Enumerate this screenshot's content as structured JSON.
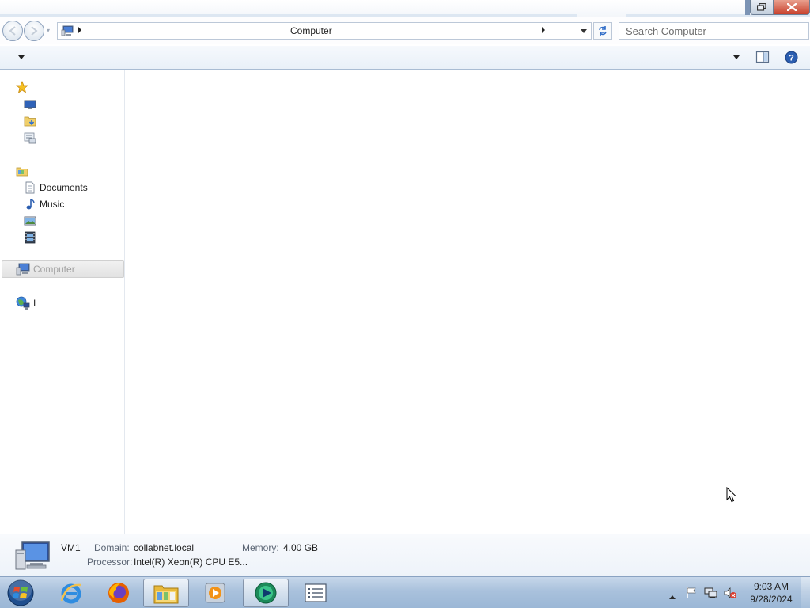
{
  "window": {
    "title_bar": {
      "restore_icon": "restore-icon",
      "close_icon": "close-icon"
    }
  },
  "nav": {
    "back_icon": "back-arrow-icon",
    "forward_icon": "forward-arrow-icon",
    "breadcrumb": "Computer",
    "refresh_icon": "refresh-icon",
    "search_placeholder": "Search Computer"
  },
  "sidebar": {
    "items": [
      {
        "icon": "favorites-star-icon",
        "label": ""
      },
      {
        "icon": "desktop-icon",
        "label": ""
      },
      {
        "icon": "downloads-icon",
        "label": ""
      },
      {
        "icon": "recent-places-icon",
        "label": ""
      },
      {
        "icon": "libraries-icon",
        "label": ""
      },
      {
        "icon": "documents-icon",
        "label": "Documents"
      },
      {
        "icon": "music-icon",
        "label": "Music"
      },
      {
        "icon": "pictures-icon",
        "label": ""
      },
      {
        "icon": "videos-icon",
        "label": ""
      },
      {
        "icon": "computer-icon",
        "label": "Computer"
      },
      {
        "icon": "network-icon",
        "label": "I"
      }
    ]
  },
  "details": {
    "name": "VM1",
    "domain_label": "Domain:",
    "domain_value": "collabnet.local",
    "memory_label": "Memory:",
    "memory_value": "4.00 GB",
    "processor_label": "Processor:",
    "processor_value": "Intel(R) Xeon(R) CPU E5..."
  },
  "taskbar": {
    "apps": [
      {
        "icon": "internet-explorer-icon"
      },
      {
        "icon": "firefox-icon"
      },
      {
        "icon": "windows-explorer-icon",
        "active": true
      },
      {
        "icon": "media-player-icon"
      },
      {
        "icon": "remote-app-icon"
      },
      {
        "icon": "list-app-icon"
      }
    ],
    "clock_time": "9:03 AM",
    "clock_date": "9/28/2024"
  },
  "colors": {
    "taskbar": "#a9c1dc",
    "close_button": "#c8412d",
    "selected_item": "#e2e2e2"
  }
}
